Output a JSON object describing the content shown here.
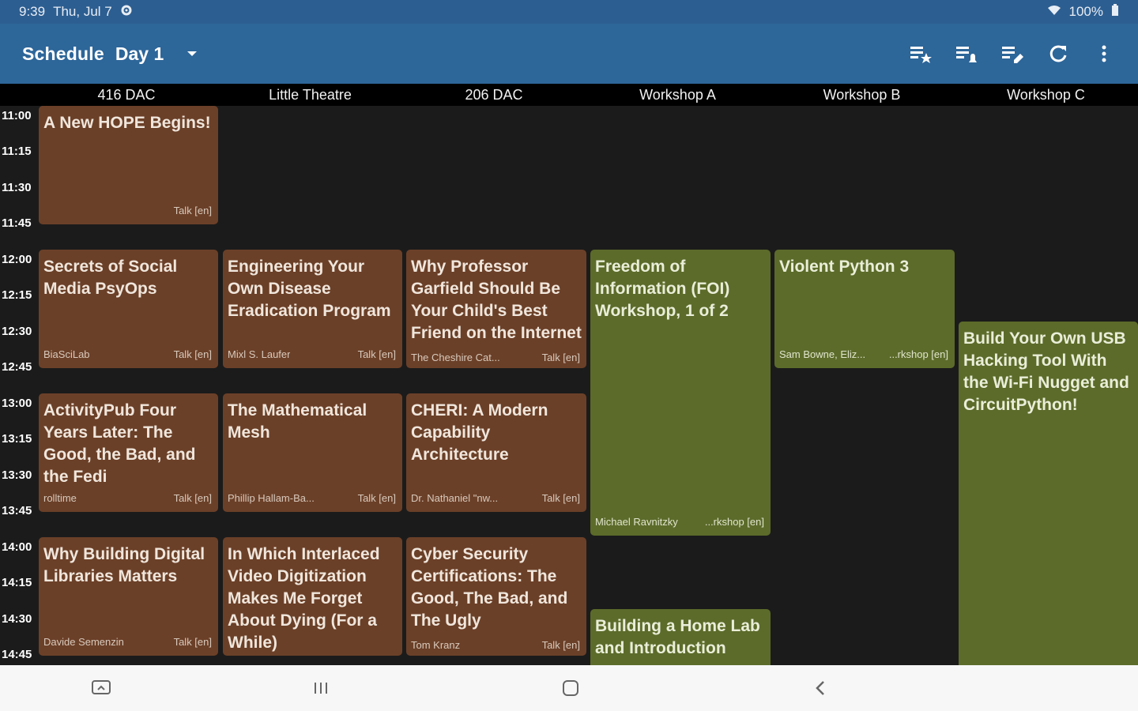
{
  "status": {
    "time": "9:39",
    "date": "Thu, Jul 7",
    "battery": "100%"
  },
  "appbar": {
    "title": "Schedule",
    "day": "Day 1"
  },
  "rooms": [
    "416 DAC",
    "Little Theatre",
    "206 DAC",
    "Workshop A",
    "Workshop B",
    "Workshop C"
  ],
  "times": [
    "11:00",
    "11:15",
    "11:30",
    "11:45",
    "12:00",
    "12:15",
    "12:30",
    "12:45",
    "13:00",
    "13:15",
    "13:30",
    "13:45",
    "14:00",
    "14:15",
    "14:30",
    "14:45"
  ],
  "events": {
    "e1": {
      "title": "A New HOPE Begins!",
      "speaker": "",
      "type": "Talk [en]"
    },
    "e2": {
      "title": "Secrets of Social Media PsyOps",
      "speaker": "BiaSciLab",
      "type": "Talk [en]"
    },
    "e3": {
      "title": "Engineering Your Own Disease Eradication Program",
      "speaker": "Mixl S. Laufer",
      "type": "Talk [en]"
    },
    "e4": {
      "title": "Why Professor Garfield Should Be Your Child's Best Friend on the Internet",
      "speaker": "The Cheshire Cat...",
      "type": "Talk [en]"
    },
    "e5": {
      "title": "Freedom of Information (FOI) Workshop, 1 of 2",
      "speaker": "Michael Ravnitzky",
      "type": "...rkshop [en]"
    },
    "e6": {
      "title": "Violent Python 3",
      "speaker": "Sam Bowne, Eliz...",
      "type": "...rkshop [en]"
    },
    "e7": {
      "title": "Build Your Own USB Hacking Tool With the Wi-Fi Nugget and CircuitPython!",
      "speaker": "",
      "type": ""
    },
    "e8": {
      "title": "ActivityPub Four Years Later: The Good, the Bad, and the Fedi",
      "speaker": "rolltime",
      "type": "Talk [en]"
    },
    "e9": {
      "title": "The Mathematical Mesh",
      "speaker": "Phillip Hallam-Ba...",
      "type": "Talk [en]"
    },
    "e10": {
      "title": "CHERI: A Modern Capability Architecture",
      "speaker": "Dr. Nathaniel \"nw...",
      "type": "Talk [en]"
    },
    "e11": {
      "title": "Why Building Digital Libraries Matters",
      "speaker": "Davide Semenzin",
      "type": "Talk [en]"
    },
    "e12": {
      "title": "In Which Interlaced Video Digitization Makes Me Forget About Dying (For a While)",
      "speaker": "",
      "type": ""
    },
    "e13": {
      "title": "Cyber Security Certifications: The Good, The Bad, and The Ugly",
      "speaker": "Tom Kranz",
      "type": "Talk [en]"
    },
    "e14": {
      "title": "Building a Home Lab and Introduction",
      "speaker": "",
      "type": ""
    }
  },
  "colors": {
    "talk": "#6b4028",
    "workshop": "#5c6b2a",
    "appbar": "#2d6699"
  },
  "icons": [
    "settings-gear-icon",
    "wifi-icon",
    "battery-icon",
    "dropdown-arrow-icon",
    "starred-list-icon",
    "alarm-list-icon",
    "edit-list-icon",
    "refresh-icon",
    "more-vert-icon",
    "recent-apps-icon",
    "home-icon",
    "back-icon",
    "keyboard-icon"
  ]
}
